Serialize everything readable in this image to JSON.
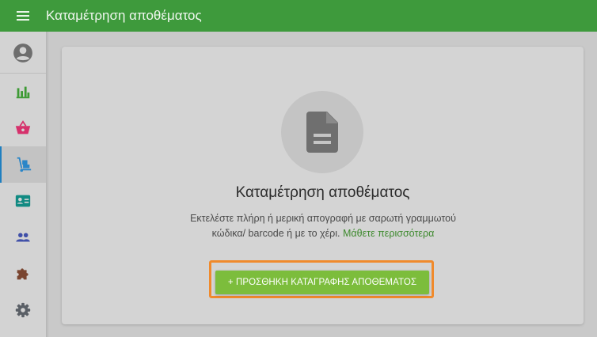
{
  "header": {
    "title": "Καταμέτρηση αποθέματος"
  },
  "sidebar": {
    "items": [
      {
        "icon": "account-circle-icon"
      },
      {
        "icon": "bar-chart-icon"
      },
      {
        "icon": "basket-icon"
      },
      {
        "icon": "hand-truck-icon",
        "active": true
      },
      {
        "icon": "id-card-icon"
      },
      {
        "icon": "people-icon"
      },
      {
        "icon": "puzzle-icon"
      },
      {
        "icon": "gear-icon"
      }
    ]
  },
  "empty_state": {
    "icon": "document-icon",
    "heading": "Καταμέτρηση αποθέματος",
    "description": "Εκτελέστε πλήρη ή μερική απογραφή με σαρωτή γραμμωτού κώδικα/ barcode ή με το χέρι.",
    "learn_more": "Μάθετε περισσότερα",
    "cta_label": "+ ΠΡΟΣΘΗΚΗ ΚΑΤΑΓΡΑΦΗΣ ΑΠΟΘΕΜΑΤΟΣ"
  },
  "colors": {
    "header": "#3e9a3c",
    "accent_link": "#3e8a2e",
    "cta": "#7cbd3c",
    "highlight": "#f08a2c",
    "active_indicator": "#1f7fc0"
  }
}
